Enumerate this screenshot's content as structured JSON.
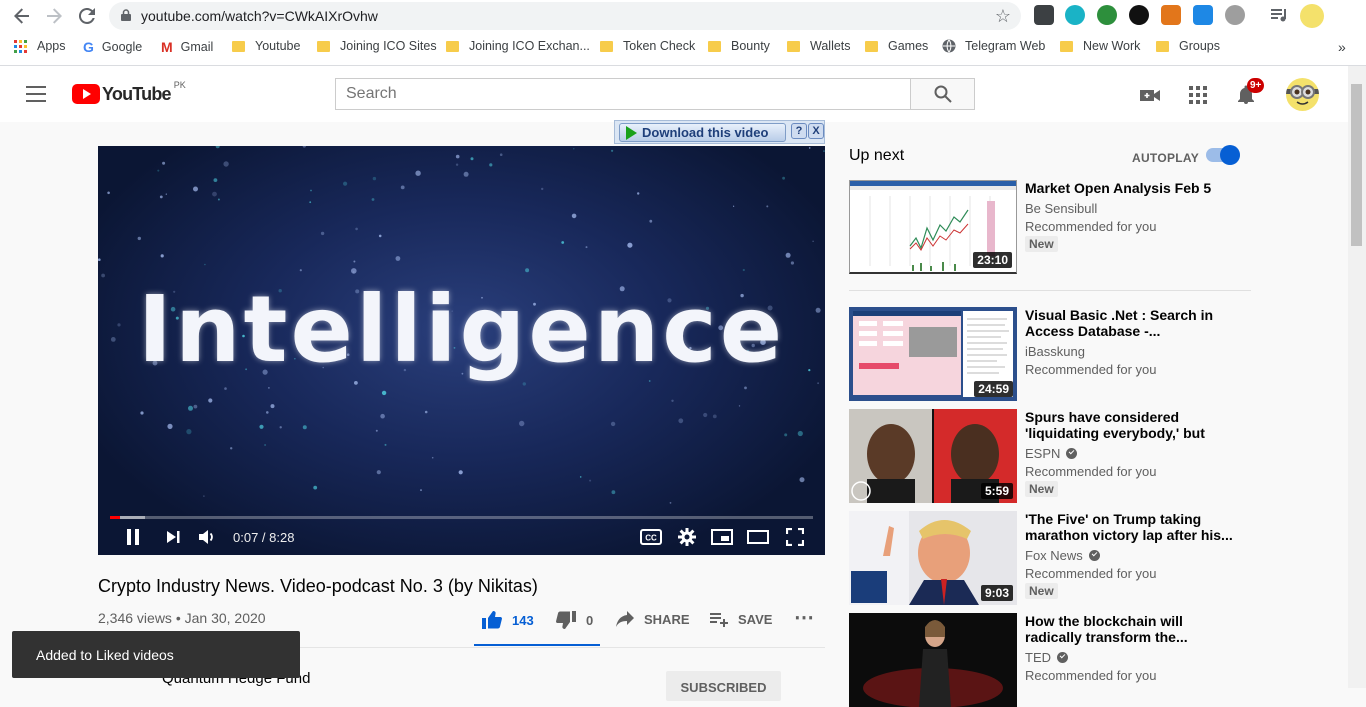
{
  "browser": {
    "url": "youtube.com/watch?v=CWkAIXrOvhw",
    "bookmarks": [
      {
        "label": "Apps",
        "icon": "apps-grid-icon"
      },
      {
        "label": "Google",
        "icon": "google-icon"
      },
      {
        "label": "Gmail",
        "icon": "gmail-icon"
      },
      {
        "label": "Youtube",
        "icon": "folder-icon"
      },
      {
        "label": "Joining ICO Sites",
        "icon": "folder-icon"
      },
      {
        "label": "Joining ICO Exchan...",
        "icon": "folder-icon"
      },
      {
        "label": "Token Check",
        "icon": "folder-icon"
      },
      {
        "label": "Bounty",
        "icon": "folder-icon"
      },
      {
        "label": "Wallets",
        "icon": "folder-icon"
      },
      {
        "label": "Games",
        "icon": "folder-icon"
      },
      {
        "label": "Telegram Web",
        "icon": "globe-icon"
      },
      {
        "label": "New Work",
        "icon": "folder-icon"
      },
      {
        "label": "Groups",
        "icon": "folder-icon"
      }
    ],
    "overflow": "»"
  },
  "header": {
    "logo_text": "YouTube",
    "logo_country": "PK",
    "search_placeholder": "Search",
    "notifications_badge": "9+"
  },
  "download_bar": {
    "label": "Download this video",
    "help": "?",
    "close": "X"
  },
  "player": {
    "frame_text": "Intelligence",
    "time": "0:07 / 8:28",
    "progress_fraction": 0.014
  },
  "video": {
    "title": "Crypto Industry News. Video-podcast No. 3 (by Nikitas)",
    "meta": "2,346 views • Jan 30, 2020",
    "likes": "143",
    "dislikes": "0",
    "share_label": "SHARE",
    "save_label": "SAVE",
    "channel_name": "Quantum Hedge Fund",
    "subscribe_label": "SUBSCRIBED"
  },
  "toast": {
    "text": "Added to Liked videos"
  },
  "sidebar": {
    "heading": "Up next",
    "autoplay_label": "AUTOPLAY",
    "autoplay_on": true,
    "items": [
      {
        "title": "Market Open Analysis Feb 5",
        "channel": "Be Sensibull",
        "verified": false,
        "reason": "Recommended for you",
        "badge": "New",
        "duration": "23:10"
      },
      {
        "title": "Visual Basic .Net : Search in Access Database -...",
        "channel": "iBasskung",
        "verified": false,
        "reason": "Recommended for you",
        "badge": "",
        "duration": "24:59"
      },
      {
        "title": "Spurs have considered 'liquidating everybody,' but cou...",
        "channel": "ESPN",
        "verified": true,
        "reason": "Recommended for you",
        "badge": "New",
        "duration": "5:59"
      },
      {
        "title": "'The Five' on Trump taking marathon victory lap after his...",
        "channel": "Fox News",
        "verified": true,
        "reason": "Recommended for you",
        "badge": "New",
        "duration": "9:03"
      },
      {
        "title": "How the blockchain will radically transform the...",
        "channel": "TED",
        "verified": true,
        "reason": "Recommended for you",
        "badge": "",
        "duration": ""
      }
    ]
  }
}
